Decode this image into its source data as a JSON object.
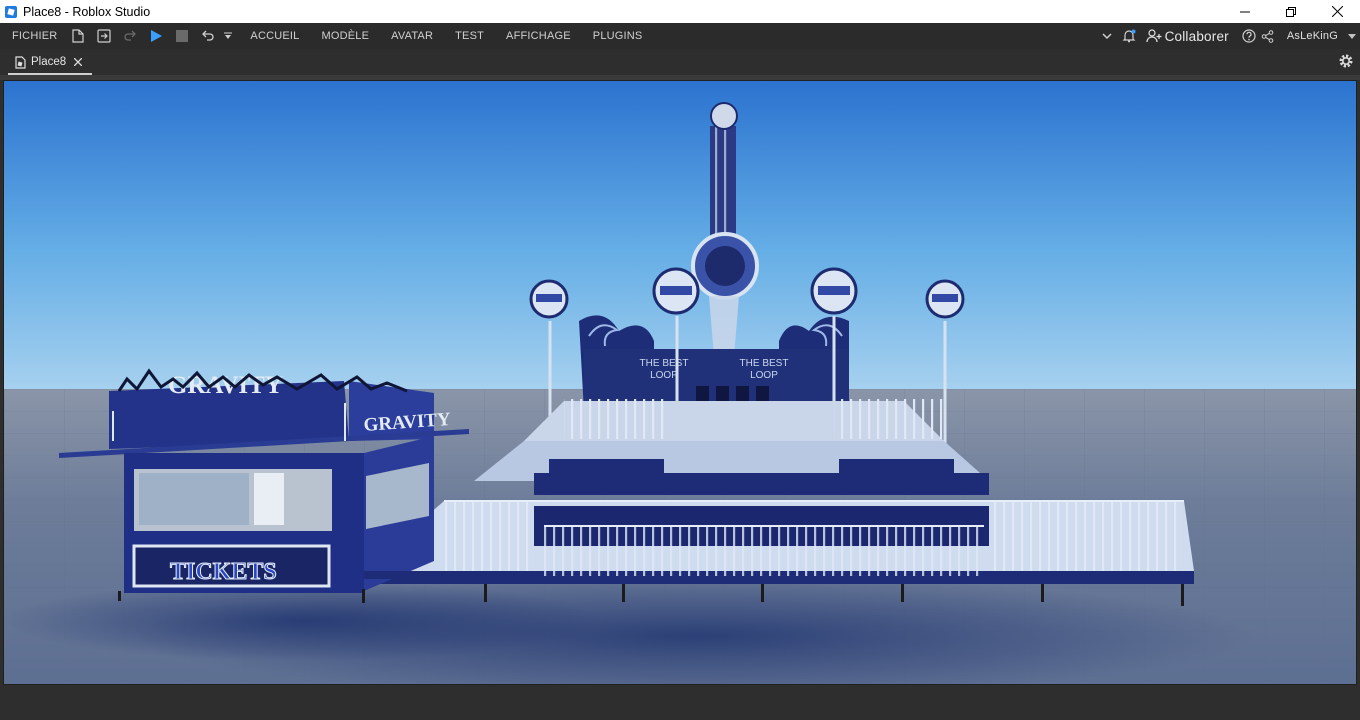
{
  "window": {
    "title": "Place8 - Roblox Studio"
  },
  "menubar": {
    "file_label": "FICHIER",
    "tabs": [
      "ACCUEIL",
      "MODÈLE",
      "AVATAR",
      "TEST",
      "AFFICHAGE",
      "PLUGINS"
    ],
    "collaborate_label": "Collaborer",
    "username": "AsLeKinG"
  },
  "document_tab": {
    "label": "Place8"
  },
  "scene": {
    "booth_sign_left": "GRAVITY",
    "booth_sign_right": "GRAVITY",
    "ticket_sign": "TICKETS",
    "banner_left": [
      "THE BEST",
      "LOOP"
    ],
    "banner_right": [
      "THE BEST",
      "LOOP"
    ]
  },
  "colors": {
    "accent_play": "#3aa0ff",
    "ride_blue": "#1c2a7a",
    "rail_white": "#d8e4f2"
  }
}
